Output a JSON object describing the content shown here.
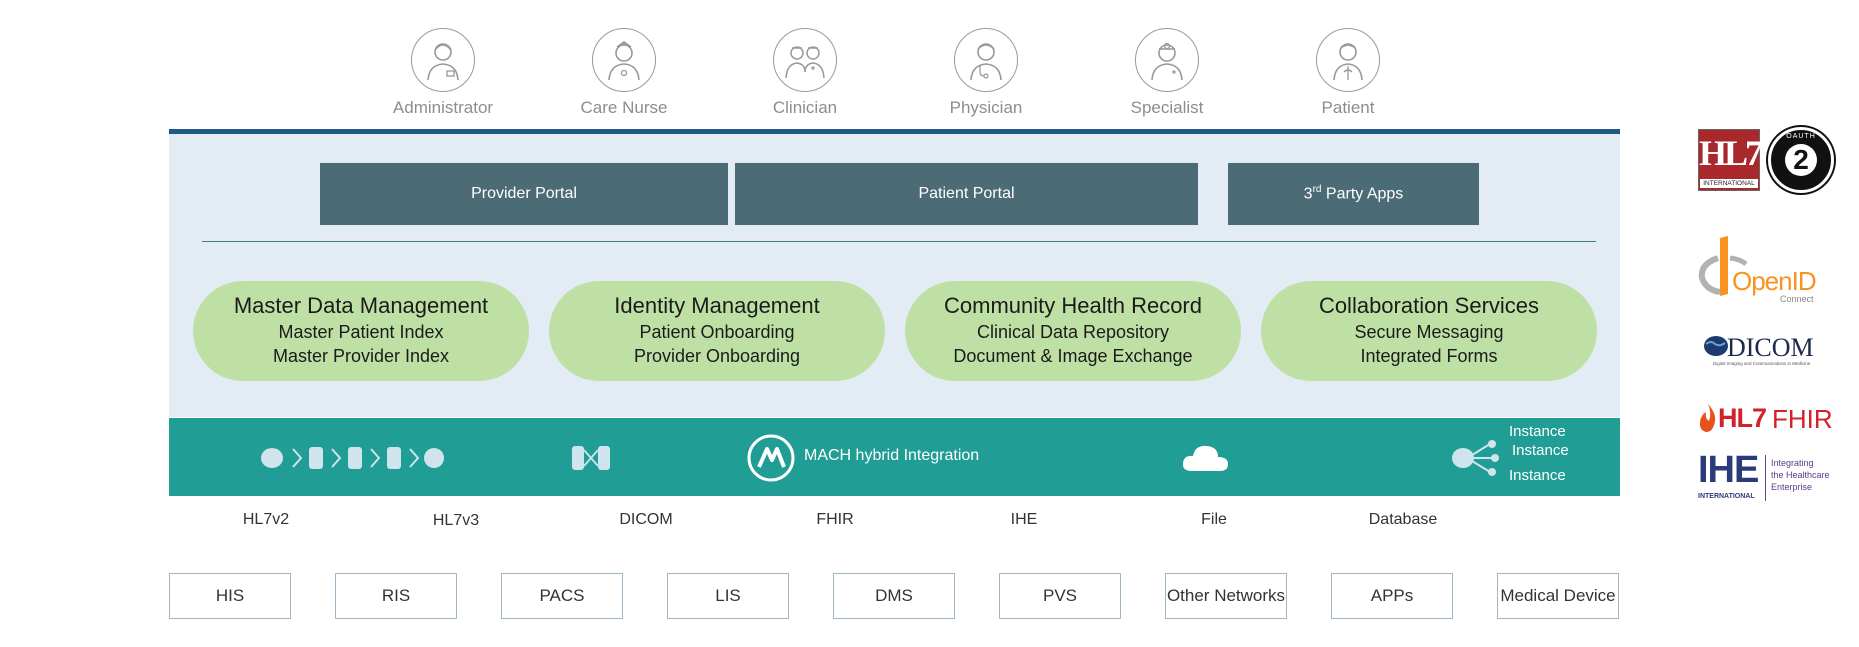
{
  "roles": [
    {
      "label": "Administrator",
      "icon": "administrator-icon"
    },
    {
      "label": "Care Nurse",
      "icon": "care-nurse-icon"
    },
    {
      "label": "Clinician",
      "icon": "clinician-icon"
    },
    {
      "label": "Physician",
      "icon": "physician-icon"
    },
    {
      "label": "Specialist",
      "icon": "specialist-icon"
    },
    {
      "label": "Patient",
      "icon": "patient-icon"
    }
  ],
  "portals": {
    "provider": "Provider Portal",
    "patient": "Patient Portal",
    "third_party_prefix": "3",
    "third_party_sup": "rd",
    "third_party_suffix": " Party Apps"
  },
  "services": [
    {
      "title": "Master Data Management",
      "items": [
        "Master Patient Index",
        "Master Provider Index"
      ]
    },
    {
      "title": "Identity Management",
      "items": [
        "Patient Onboarding",
        "Provider Onboarding"
      ]
    },
    {
      "title": "Community Health Record",
      "items": [
        "Clinical Data Repository",
        "Document & Image Exchange"
      ]
    },
    {
      "title": "Collaboration Services",
      "items": [
        "Secure Messaging",
        "Integrated Forms"
      ]
    }
  ],
  "integration": {
    "label": "MACH hybrid Integration",
    "instances": [
      "Instance",
      "Instance",
      "Instance"
    ]
  },
  "protocols": [
    "HL7v2",
    "HL7v3",
    "DICOM",
    "FHIR",
    "IHE",
    "File",
    "Database"
  ],
  "systems": [
    "HIS",
    "RIS",
    "PACS",
    "LIS",
    "DMS",
    "PVS",
    "Other Networks",
    "APPs",
    "Medical Device"
  ],
  "logos": {
    "hl7_letters": "HL7",
    "hl7_sub": "INTERNATIONAL",
    "oauth_number": "2",
    "oauth_text": "OAUTH",
    "openid": "OpenID",
    "openid_sub": "Connect",
    "dicom": "DICOM",
    "dicom_sub": "Digital Imaging and Communications in Medicine",
    "fhir_hl7": "HL7",
    "fhir": "FHIR",
    "ihe": "IHE",
    "ihe_sub": "INTERNATIONAL",
    "ihe_tagline": [
      "Integrating",
      "the Healthcare",
      "Enterprise"
    ]
  },
  "colors": {
    "panel_bg": "#e3ecf4",
    "panel_top_border": "#1f5a85",
    "portal_bg": "#4b6b77",
    "pill_bg": "#bfe0a5",
    "integration_bar": "#209d94"
  }
}
